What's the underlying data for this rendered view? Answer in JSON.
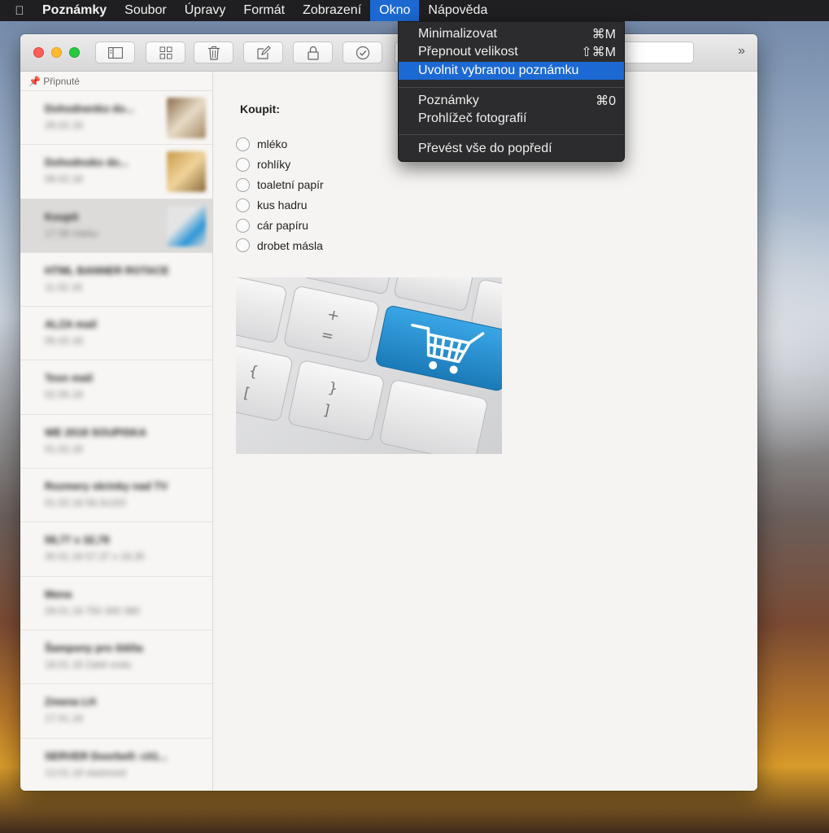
{
  "menubar": {
    "apple": "",
    "app_name": "Poznámky",
    "items": [
      "Soubor",
      "Úpravy",
      "Formát",
      "Zobrazení",
      "Okno",
      "Nápověda"
    ]
  },
  "window_menu": {
    "items": [
      {
        "label": "Minimalizovat",
        "shortcut": "⌘M"
      },
      {
        "label": "Přepnout velikost",
        "shortcut": "⇧⌘M"
      },
      {
        "label": "Uvolnit vybranou poznámku",
        "shortcut": ""
      },
      {
        "label": "Poznámky",
        "shortcut": "⌘0"
      },
      {
        "label": "Prohlížeč fotografií",
        "shortcut": ""
      },
      {
        "label": "Převést vše do popředí",
        "shortcut": ""
      }
    ]
  },
  "toolbar": {
    "icons": [
      "sidebar-icon",
      "grid-icon",
      "trash-icon",
      "compose-icon",
      "lock-icon",
      "checklist-icon"
    ],
    "overflow": "»"
  },
  "sidebar": {
    "pinned_label": "📌 Připnuté",
    "notes": [
      {
        "title": "Dohodnenko do...",
        "sub": "26.02.18"
      },
      {
        "title": "Dohodnoko do...",
        "sub": "09.02.18"
      },
      {
        "title": "Koupit",
        "sub": "17:38  mléko"
      },
      {
        "title": "HTML BANNER ROTACE",
        "sub": "11.02.18"
      },
      {
        "title": "ALZA mail",
        "sub": "05.02.18"
      },
      {
        "title": "Tesn mail",
        "sub": "02.05.18"
      },
      {
        "title": "WE 2018 SOUPISKA",
        "sub": "01.02.18"
      },
      {
        "title": "Rozmery skrinky nad TV",
        "sub": "01.02.18  58,3x163"
      },
      {
        "title": "58,77 x 32,78",
        "sub": "30.01.18  57,37 x 18,35"
      },
      {
        "title": "Mena",
        "sub": "29.01.18  750 300 380"
      },
      {
        "title": "Šampony pro štěňa",
        "sub": "18.01.18  Zabit vodu"
      },
      {
        "title": "Zmena LH",
        "sub": "17.01.18"
      },
      {
        "title": "SERVER Doorbell: cit1...",
        "sub": "13.01.18  vlastnosti"
      }
    ]
  },
  "note": {
    "heading": "Koupit:",
    "items": [
      "mléko",
      "rohlíky",
      "toaletní papír",
      "kus hadru",
      "cár papíru",
      "drobet másla"
    ],
    "image_alt": "keyboard-shopping-cart"
  },
  "colors": {
    "accent": "#1c69d3",
    "menubar": "#1f1f21",
    "cart_key": "#2b96d6"
  }
}
